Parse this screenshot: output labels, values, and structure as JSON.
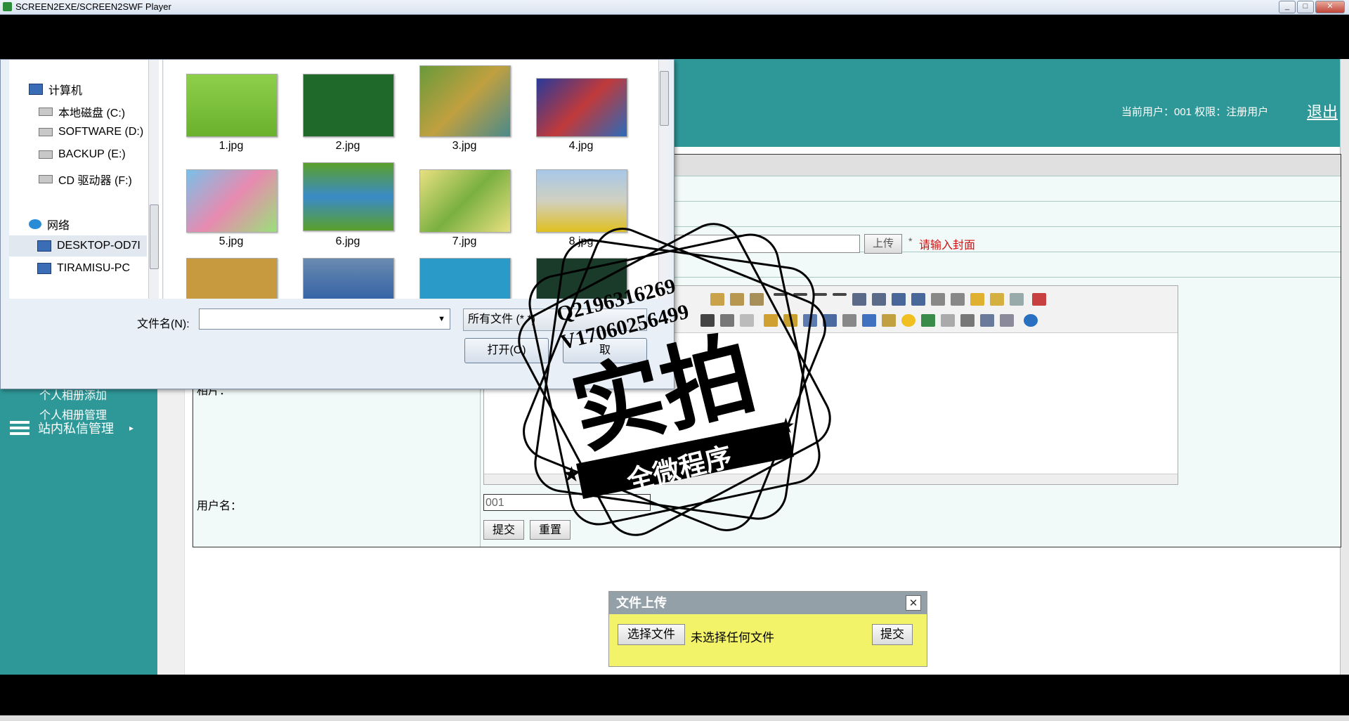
{
  "window": {
    "title": "SCREEN2EXE/SCREEN2SWF Player",
    "min": "_",
    "max": "□",
    "close": "✕"
  },
  "header": {
    "user_info": "当前用户：001  权限：注册用户",
    "logout": "退出"
  },
  "sidebar": {
    "items": [
      "个人相册添加",
      "个人相册管理"
    ],
    "section": "站内私信管理",
    "section_arrow": "▸"
  },
  "form": {
    "upload_label": "上传",
    "required_mark": "*",
    "cover_hint": "请输入封面",
    "content_label": "相片：",
    "username_label": "用户名：",
    "username_value": "001",
    "submit": "提交",
    "reset": "重置"
  },
  "upload_dialog": {
    "title": "文件上传",
    "close": "✕",
    "choose": "选择文件",
    "status": "未选择任何文件",
    "submit": "提交"
  },
  "file_dialog": {
    "tree": [
      {
        "label": "计算机",
        "icon": "computer-icon"
      },
      {
        "label": "本地磁盘 (C:)",
        "icon": "drive-icon"
      },
      {
        "label": "SOFTWARE (D:)",
        "icon": "drive-icon"
      },
      {
        "label": "BACKUP (E:)",
        "icon": "drive-icon"
      },
      {
        "label": "CD 驱动器 (F:)",
        "icon": "cd-drive-icon"
      },
      {
        "label": "网络",
        "icon": "network-icon"
      },
      {
        "label": "DESKTOP-OD7I",
        "icon": "computer-icon"
      },
      {
        "label": "TIRAMISU-PC",
        "icon": "computer-icon"
      }
    ],
    "files": [
      "1.jpg",
      "2.jpg",
      "3.jpg",
      "4.jpg",
      "5.jpg",
      "6.jpg",
      "7.jpg",
      "8.jpg"
    ],
    "filename_label": "文件名(N):",
    "filename_value": "",
    "filetype": "所有文件 (*.*)",
    "open": "打开(O)",
    "cancel": "取"
  },
  "watermark": {
    "line1": "Q2196316269",
    "line2": "V17060256499",
    "main": "实拍",
    "ribbon": "全微程序"
  }
}
